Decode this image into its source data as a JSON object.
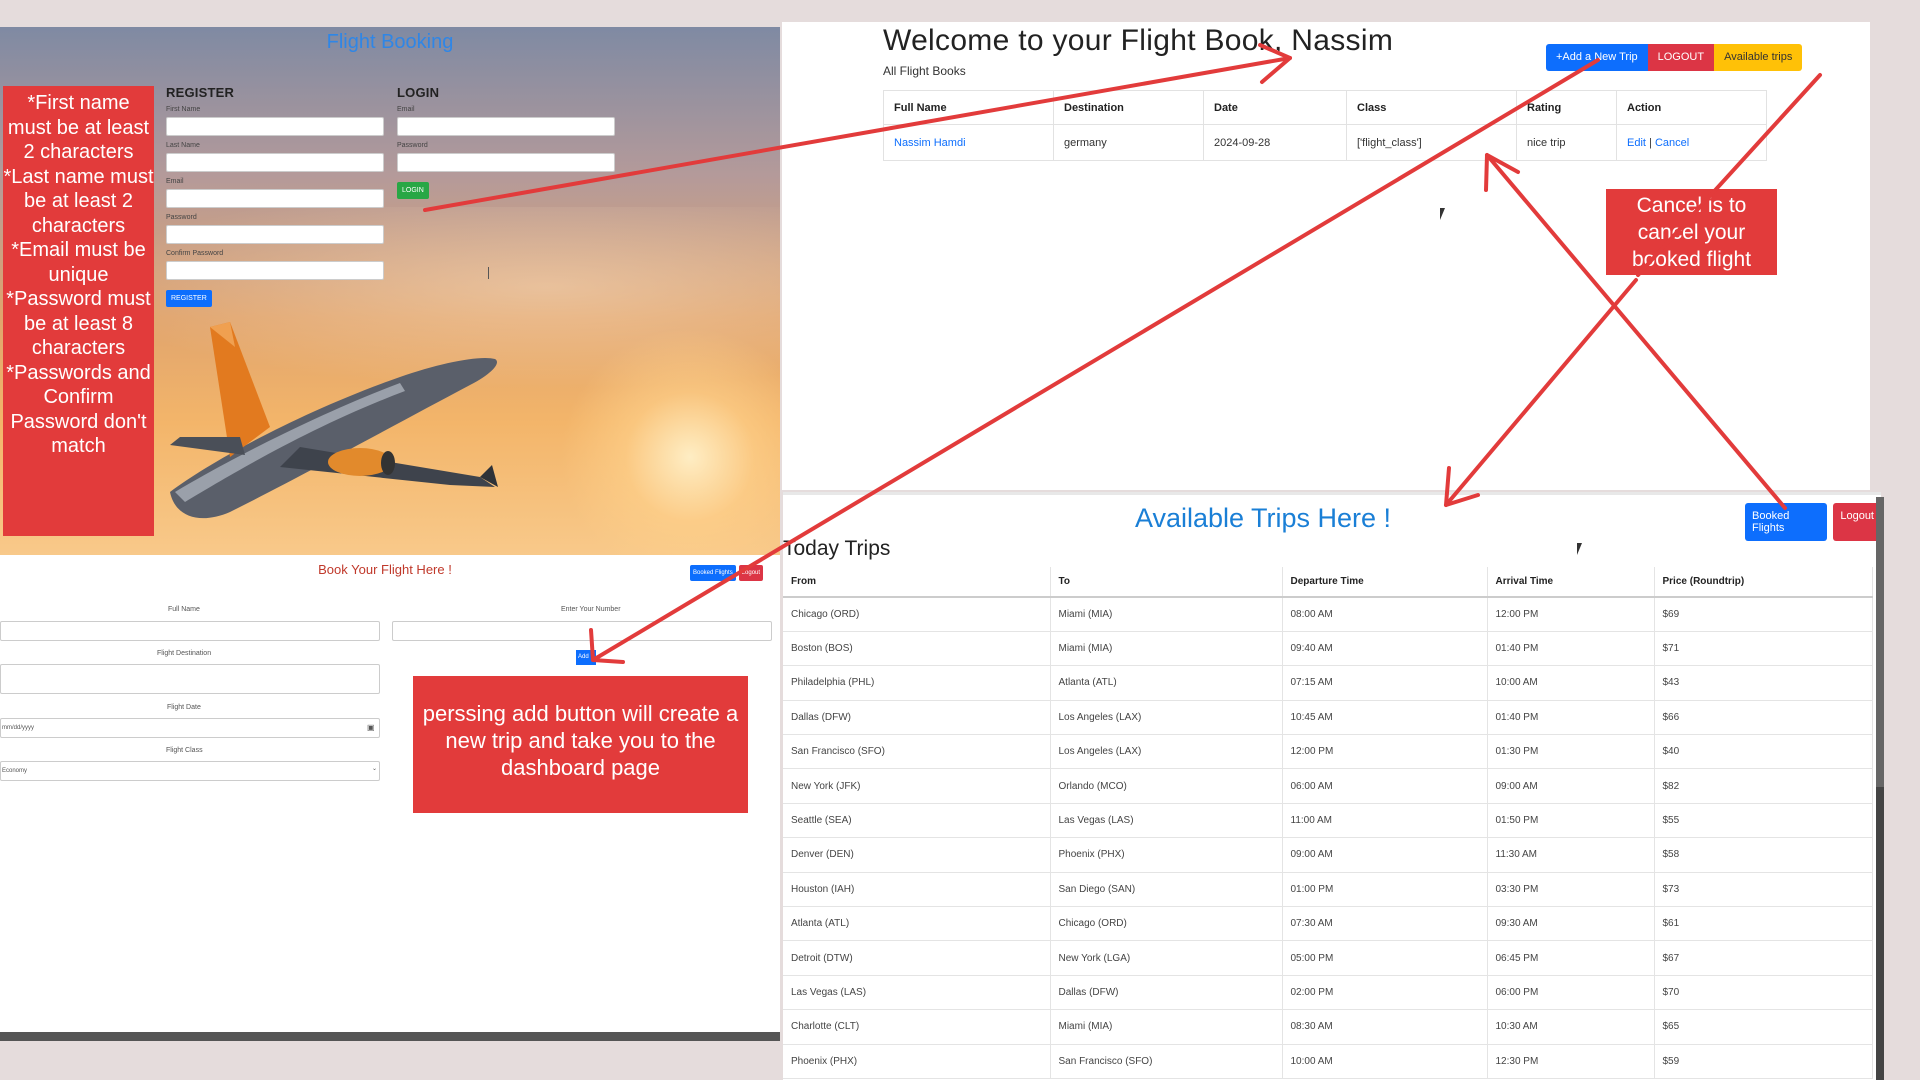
{
  "login_page": {
    "brand": "Flight Booking",
    "register": {
      "heading": "REGISTER",
      "fields": [
        "First Name",
        "Last Name",
        "Email",
        "Password",
        "Confirm Password"
      ],
      "button": "REGISTER"
    },
    "login": {
      "heading": "LOGIN",
      "fields": [
        "Email",
        "Password"
      ],
      "button": "LOGIN"
    }
  },
  "notes": {
    "validation": "*First name must be at least 2 characters *Last name must be at least 2 characters *Email must be unique *Password must be at least 8 characters *Passwords and Confirm Password don't match",
    "cancel": "Cancel is to cancel your booked flight",
    "add": "perssing add button will create a new trip and take you to the dashboard page"
  },
  "dashboard": {
    "welcome": "Welcome to your Flight Book, Nassim",
    "subtitle": "All Flight Books",
    "buttons": {
      "add": "+Add a New Trip",
      "logout": "LOGOUT",
      "available": "Available trips"
    },
    "columns": [
      "Full Name",
      "Destination",
      "Date",
      "Class",
      "Rating",
      "Action"
    ],
    "row": {
      "name": "Nassim Hamdi",
      "destination": "germany",
      "date": "2024-09-28",
      "class": "['flight_class']",
      "rating": "nice trip",
      "edit": "Edit",
      "sep": "|",
      "cancel": "Cancel"
    }
  },
  "book_page": {
    "title": "Book Your Flight Here !",
    "buttons": {
      "booked": "Booked Flights",
      "logout": "Logout"
    },
    "labels": {
      "full_name": "Full Name",
      "phone": "Enter Your Number",
      "destination": "Flight Destination",
      "date": "Flight Date",
      "class": "Flight Class"
    },
    "values": {
      "date": "mm/dd/yyyy",
      "class": "Economy"
    },
    "add_button": "Add"
  },
  "trips_page": {
    "title": "Available Trips Here !",
    "buttons": {
      "booked": "Booked Flights",
      "logout": "Logout"
    },
    "section": "Today Trips",
    "columns": [
      "From",
      "To",
      "Departure Time",
      "Arrival Time",
      "Price (Roundtrip)"
    ],
    "rows": [
      [
        "Chicago (ORD)",
        "Miami (MIA)",
        "08:00 AM",
        "12:00 PM",
        "$69"
      ],
      [
        "Boston (BOS)",
        "Miami (MIA)",
        "09:40 AM",
        "01:40 PM",
        "$71"
      ],
      [
        "Philadelphia (PHL)",
        "Atlanta (ATL)",
        "07:15 AM",
        "10:00 AM",
        "$43"
      ],
      [
        "Dallas (DFW)",
        "Los Angeles (LAX)",
        "10:45 AM",
        "01:40 PM",
        "$66"
      ],
      [
        "San Francisco (SFO)",
        "Los Angeles (LAX)",
        "12:00 PM",
        "01:30 PM",
        "$40"
      ],
      [
        "New York (JFK)",
        "Orlando (MCO)",
        "06:00 AM",
        "09:00 AM",
        "$82"
      ],
      [
        "Seattle (SEA)",
        "Las Vegas (LAS)",
        "11:00 AM",
        "01:50 PM",
        "$55"
      ],
      [
        "Denver (DEN)",
        "Phoenix (PHX)",
        "09:00 AM",
        "11:30 AM",
        "$58"
      ],
      [
        "Houston (IAH)",
        "San Diego (SAN)",
        "01:00 PM",
        "03:30 PM",
        "$73"
      ],
      [
        "Atlanta (ATL)",
        "Chicago (ORD)",
        "07:30 AM",
        "09:30 AM",
        "$61"
      ],
      [
        "Detroit (DTW)",
        "New York (LGA)",
        "05:00 PM",
        "06:45 PM",
        "$67"
      ],
      [
        "Las Vegas (LAS)",
        "Dallas (DFW)",
        "02:00 PM",
        "06:00 PM",
        "$70"
      ],
      [
        "Charlotte (CLT)",
        "Miami (MIA)",
        "08:30 AM",
        "10:30 AM",
        "$65"
      ],
      [
        "Phoenix (PHX)",
        "San Francisco (SFO)",
        "10:00 AM",
        "12:30 PM",
        "$59"
      ]
    ]
  },
  "colors": {
    "annotation_red": "#e23b3b",
    "primary": "#0d6efd",
    "danger": "#dc3545",
    "warning": "#ffc107",
    "success": "#28a745"
  }
}
